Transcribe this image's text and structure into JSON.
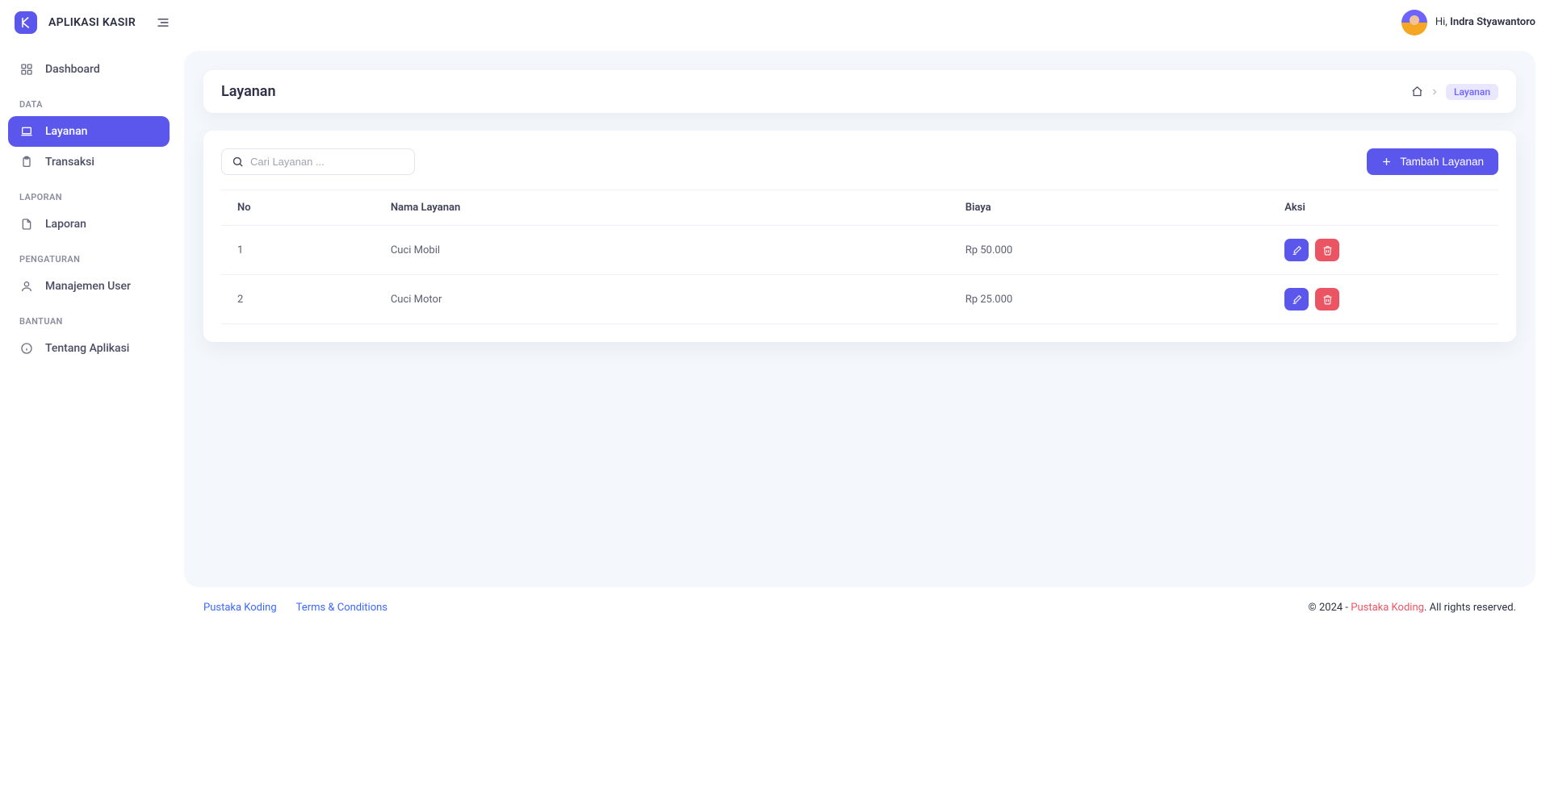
{
  "app": {
    "name": "APLIKASI KASIR"
  },
  "header": {
    "greet_prefix": "Hi, ",
    "user_name": "Indra Styawantoro"
  },
  "sidebar": {
    "items": [
      {
        "label": "Dashboard",
        "icon": "grid"
      }
    ],
    "sections": [
      {
        "title": "DATA",
        "items": [
          {
            "label": "Layanan",
            "icon": "laptop",
            "active": true
          },
          {
            "label": "Transaksi",
            "icon": "clipboard"
          }
        ]
      },
      {
        "title": "LAPORAN",
        "items": [
          {
            "label": "Laporan",
            "icon": "file"
          }
        ]
      },
      {
        "title": "PENGATURAN",
        "items": [
          {
            "label": "Manajemen User",
            "icon": "user"
          }
        ]
      },
      {
        "title": "BANTUAN",
        "items": [
          {
            "label": "Tentang Aplikasi",
            "icon": "info"
          }
        ]
      }
    ]
  },
  "page": {
    "title": "Layanan",
    "breadcrumb_current": "Layanan"
  },
  "search": {
    "placeholder": "Cari Layanan ..."
  },
  "actions": {
    "add_button": "Tambah Layanan"
  },
  "table": {
    "columns": {
      "no": "No",
      "nama": "Nama Layanan",
      "biaya": "Biaya",
      "aksi": "Aksi"
    },
    "rows": [
      {
        "no": "1",
        "nama": "Cuci Mobil",
        "biaya": "Rp 50.000"
      },
      {
        "no": "2",
        "nama": "Cuci Motor",
        "biaya": "Rp 25.000"
      }
    ]
  },
  "footer": {
    "link1": "Pustaka Koding",
    "link2": "Terms & Conditions",
    "copyright_pre": "© 2024 - ",
    "copyright_link": "Pustaka Koding",
    "copyright_post": ". All rights reserved."
  }
}
